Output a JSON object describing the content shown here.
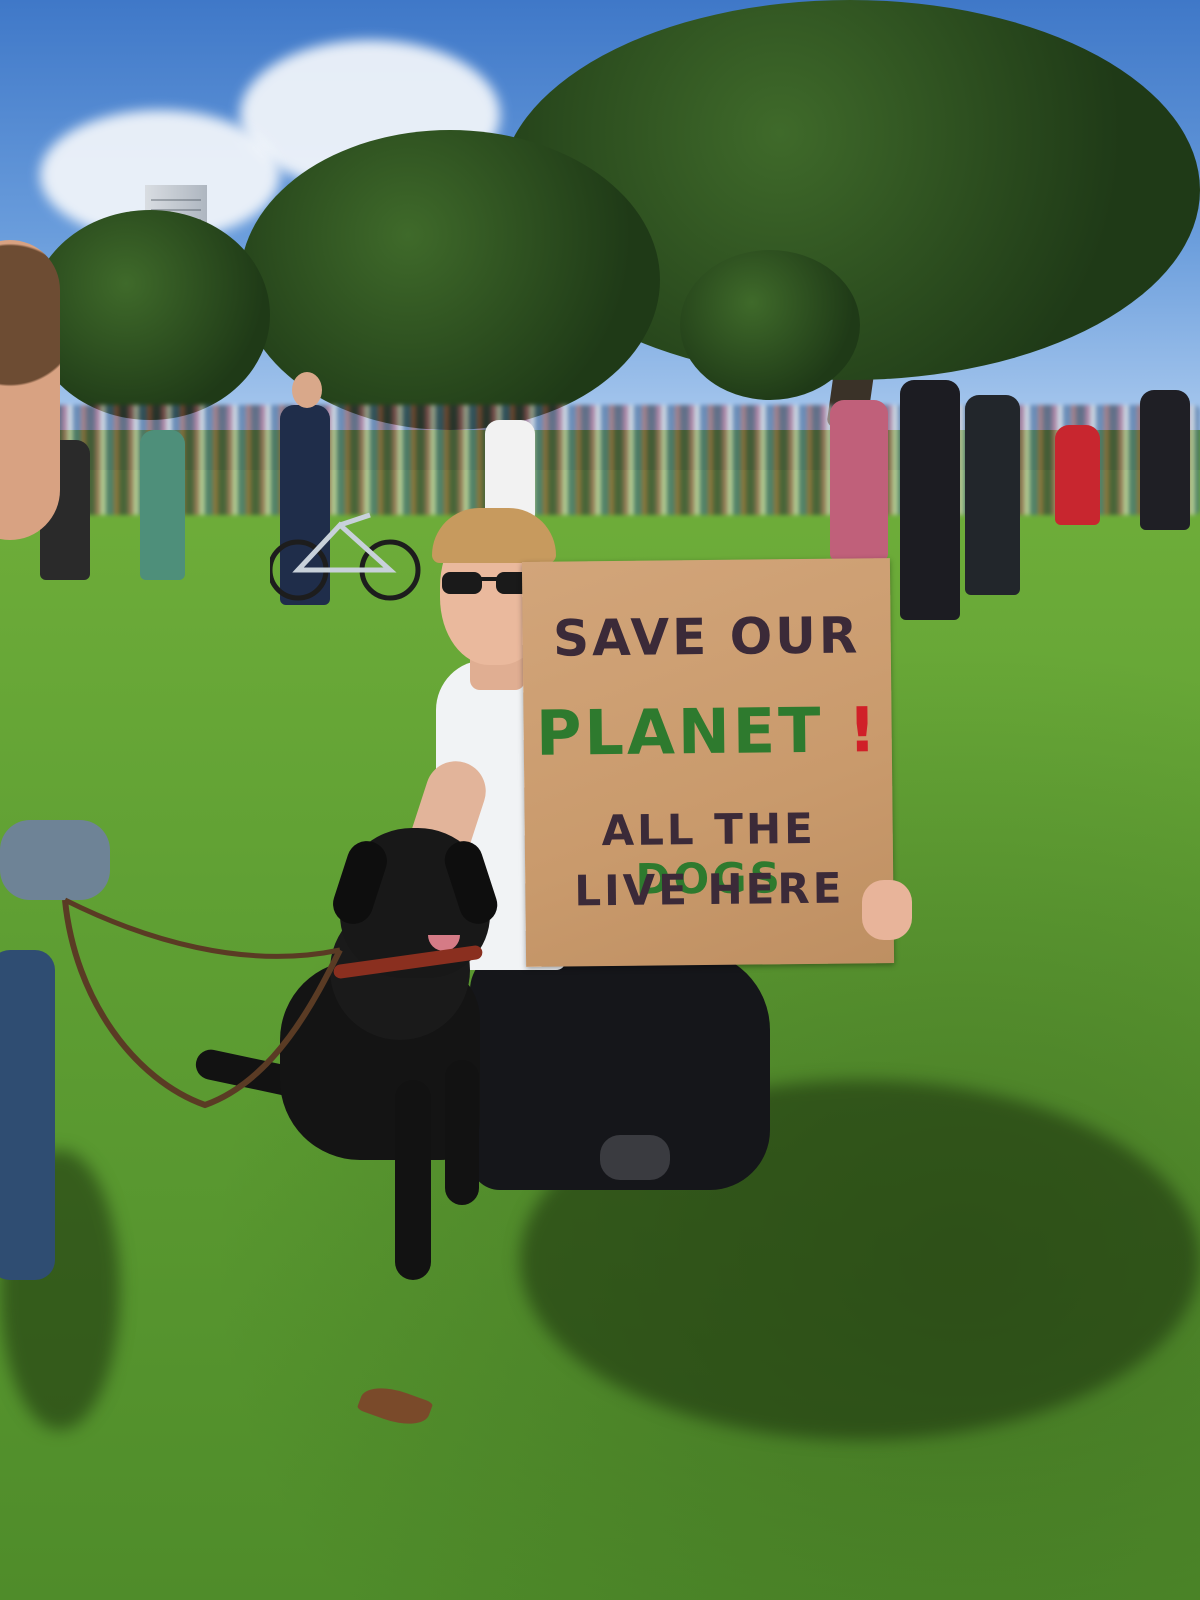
{
  "sign": {
    "line1": "SAVE OUR",
    "line2_word": "PLANET",
    "line2_mark": "!",
    "line3_start": "ALL THE",
    "line3_end": "DOGS",
    "line4": "LIVE HERE"
  },
  "colors": {
    "sign_dark": "#3b2a38",
    "sign_green": "#2e7a2e",
    "sign_red": "#d02028",
    "cardboard": "#c99a6c",
    "grass": "#5f9f33",
    "sky": "#4f86cf"
  }
}
